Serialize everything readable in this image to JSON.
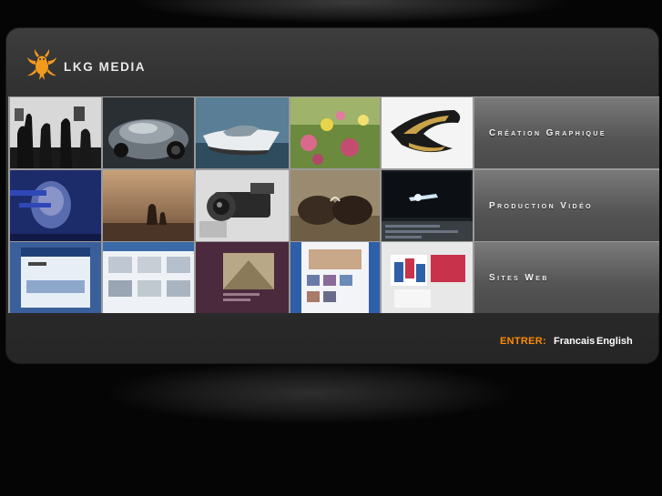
{
  "brand": {
    "name": "LKG MEDIA"
  },
  "sections": [
    {
      "label": "Création Graphique"
    },
    {
      "label": "Production Vidéo"
    },
    {
      "label": "Sites Web"
    }
  ],
  "entry": {
    "label": "ENTRER:",
    "languages": [
      "Francais",
      "English"
    ]
  },
  "colors": {
    "accent": "#ff8a00",
    "logo": "#f39a1e",
    "panel": "#2e2e2e",
    "background": "#050505"
  },
  "icons": [
    "lkg-logo-icon"
  ]
}
